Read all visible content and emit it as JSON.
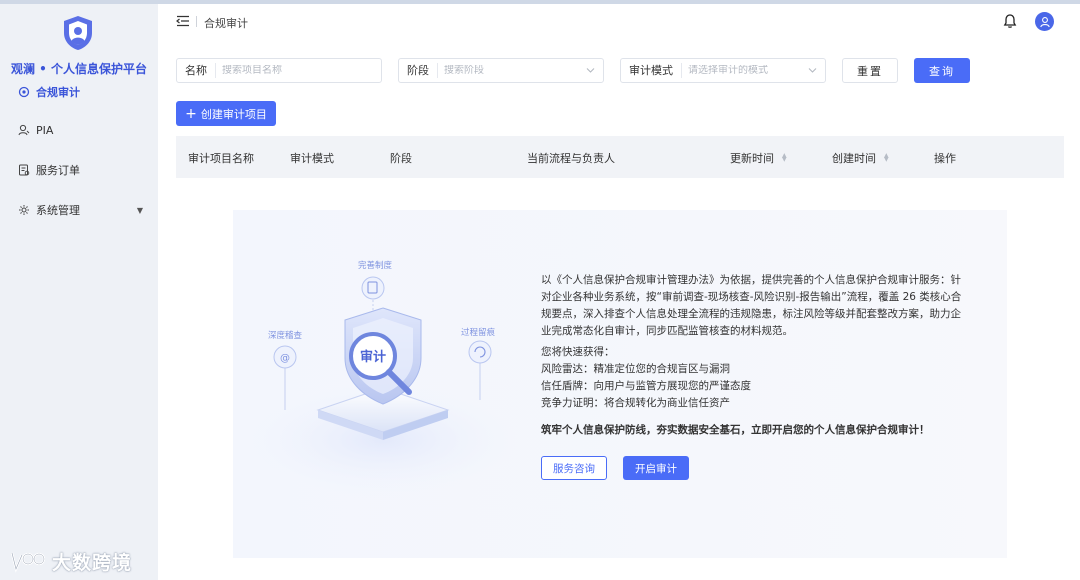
{
  "app": {
    "brand_name": "观澜 • 个人信息保护平台"
  },
  "sidebar": {
    "items": [
      {
        "label": "合规审计",
        "icon": "audit-icon",
        "active": true
      },
      {
        "label": "PIA",
        "icon": "user-search-icon",
        "active": false
      },
      {
        "label": "服务订单",
        "icon": "order-icon",
        "active": false
      },
      {
        "label": "系统管理",
        "icon": "gear-icon",
        "active": false,
        "has_submenu": true
      }
    ]
  },
  "header": {
    "breadcrumb": "合规审计"
  },
  "filters": {
    "name": {
      "label": "名称",
      "placeholder": "搜索项目名称",
      "value": ""
    },
    "stage": {
      "label": "阶段",
      "placeholder": "搜索阶段",
      "value": ""
    },
    "mode": {
      "label": "审计模式",
      "placeholder": "请选择审计的模式",
      "value": ""
    },
    "reset_label": "重置",
    "query_label": "查询"
  },
  "toolbar": {
    "create_label": "创建审计项目"
  },
  "table": {
    "columns": [
      "审计项目名称",
      "审计模式",
      "阶段",
      "当前流程与负责人",
      "更新时间",
      "创建时间",
      "操作"
    ]
  },
  "empty_state": {
    "illustration": {
      "center_badge": "审计",
      "top_label": "完善制度",
      "left_label": "深度稽查",
      "right_label": "过程留痕"
    },
    "intro": "以《个人信息保护合规审计管理办法》为依据，提供完善的个人信息保护合规审计服务：针对企业各种业务系统，按“审前调查-现场核查-风险识别-报告输出”流程，覆盖 26 类核心合规要点，深入排查个人信息处理全流程的违规隐患，标注风险等级并配套整改方案，助力企业完成常态化自审计，同步匹配监管核查的材料规范。",
    "benefits_title": "您将快速获得：",
    "benefits": [
      "风险雷达：精准定位您的合规盲区与漏洞",
      "信任盾牌：向用户与监管方展现您的严谨态度",
      "竞争力证明：将合规转化为商业信任资产"
    ],
    "call_to_action": "筑牢个人信息保护防线，夯实数据安全基石，立即开启您的个人信息保护合规审计！",
    "consult_label": "服务咨询",
    "start_label": "开启审计"
  },
  "watermark": {
    "text": "大数跨境"
  },
  "colors": {
    "primary": "#4a6cf7",
    "brand": "#3b55d9",
    "sidebar_bg": "#eef1f6",
    "table_header_bg": "#f1f3f7"
  }
}
